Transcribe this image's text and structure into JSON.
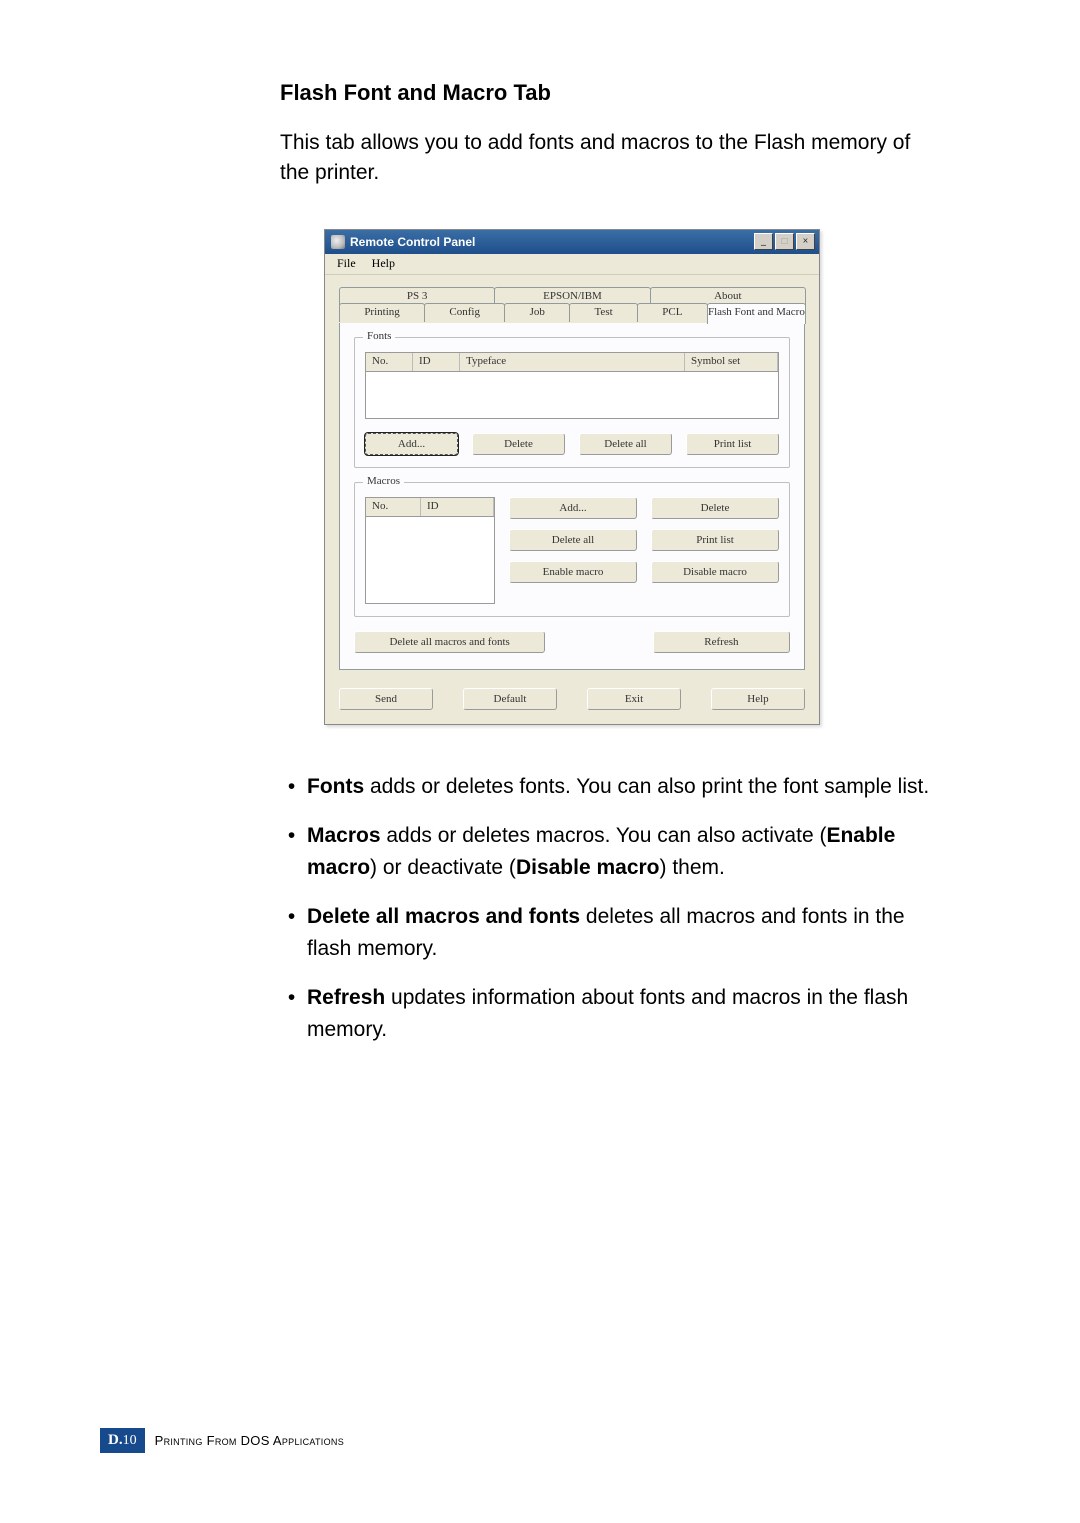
{
  "doc": {
    "heading": "Flash Font and Macro Tab",
    "intro": "This tab allows you to add fonts and macros to the Flash memory of the printer."
  },
  "dialog": {
    "title": "Remote Control Panel",
    "win_controls": {
      "min": "_",
      "max": "□",
      "close": "×"
    },
    "menu": {
      "file": "File",
      "help": "Help"
    },
    "tabs_row1": {
      "ps3": "PS 3",
      "epsonibm": "EPSON/IBM",
      "about": "About"
    },
    "tabs_row2": {
      "printing": "Printing",
      "config": "Config",
      "job": "Job",
      "test": "Test",
      "pcl": "PCL",
      "flash": "Flash Font and Macro"
    },
    "fonts_group": {
      "title": "Fonts",
      "headers": {
        "no": "No.",
        "id": "ID",
        "typeface": "Typeface",
        "symbolset": "Symbol set"
      },
      "buttons": {
        "add": "Add...",
        "delete": "Delete",
        "delete_all": "Delete all",
        "print_list": "Print list"
      }
    },
    "macros_group": {
      "title": "Macros",
      "headers": {
        "no": "No.",
        "id": "ID"
      },
      "buttons": {
        "add": "Add...",
        "delete": "Delete",
        "delete_all": "Delete all",
        "print_list": "Print list",
        "enable": "Enable macro",
        "disable": "Disable macro"
      }
    },
    "bottom_buttons": {
      "delete_all_mf": "Delete all macros and fonts",
      "refresh": "Refresh"
    },
    "global_buttons": {
      "send": "Send",
      "default": "Default",
      "exit": "Exit",
      "help": "Help"
    }
  },
  "bullets": {
    "fonts_b": "Fonts",
    "fonts_t": " adds or deletes fonts. You can also print the font sample list.",
    "macros_b": "Macros",
    "macros_t1": " adds or deletes macros. You can also activate (",
    "enable_b": "Enable macro",
    "macros_t2": ") or deactivate (",
    "disable_b": "Disable macro",
    "macros_t3": ") them.",
    "delall_b": "Delete all macros and fonts",
    "delall_t": " deletes all macros and fonts in the flash memory.",
    "refresh_b": "Refresh",
    "refresh_t": " updates information about fonts and macros in the flash memory."
  },
  "footer": {
    "page_prefix": "D.",
    "page_number": "10",
    "section": "Printing From DOS Applications"
  }
}
